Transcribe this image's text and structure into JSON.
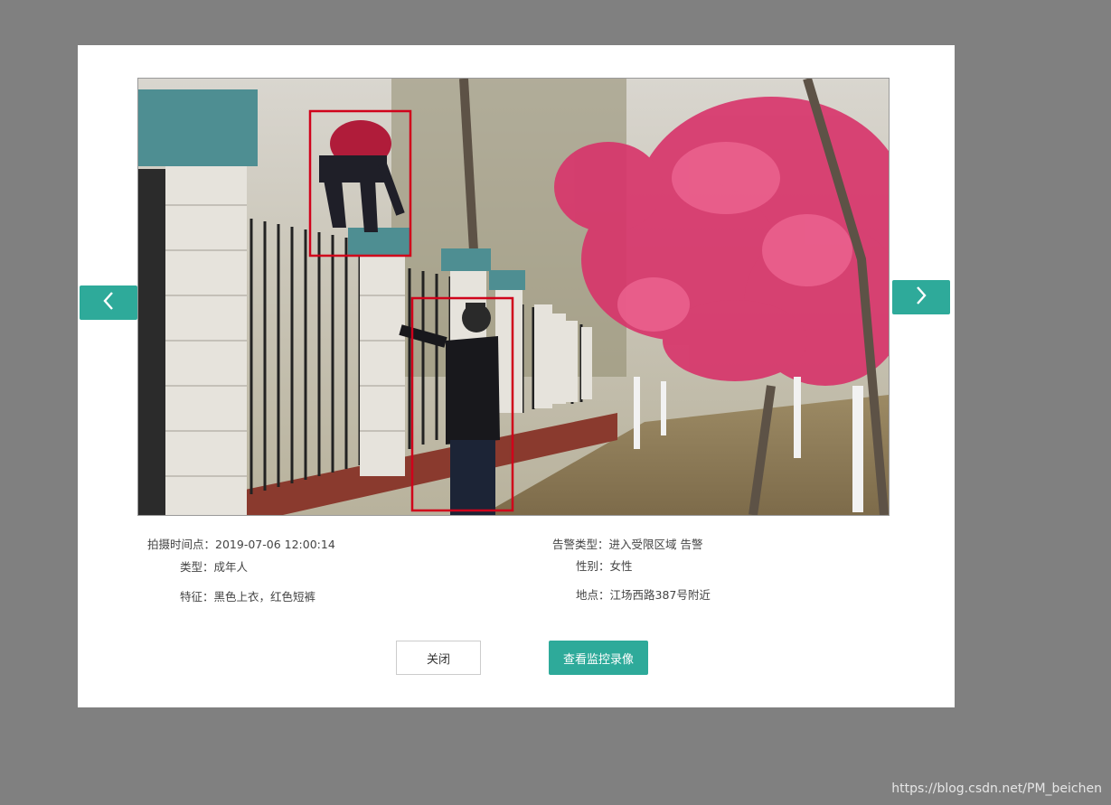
{
  "dialog": {
    "nav": {
      "prev_icon": "chevron-left-icon",
      "next_icon": "chevron-right-icon"
    },
    "info": {
      "capture_time": {
        "label": "拍摄时间点：",
        "value": "2019-07-06 12:00:14"
      },
      "alarm_type": {
        "label": "告警类型：",
        "value": "进入受限区域 告警"
      },
      "person_type": {
        "label": "类型：",
        "value": "成年人"
      },
      "gender": {
        "label": "性别：",
        "value": "女性"
      },
      "features": {
        "label": "特征：",
        "value": "黑色上衣，红色短裤"
      },
      "location": {
        "label": "地点：",
        "value": "江场西路387号附近"
      }
    },
    "buttons": {
      "close": "关闭",
      "view_video": "查看监控录像"
    },
    "colors": {
      "accent": "#2eaa9a",
      "detection_box": "#d0021b",
      "overlay": "#808080"
    }
  },
  "watermark": "https://blog.csdn.net/PM_beichen"
}
